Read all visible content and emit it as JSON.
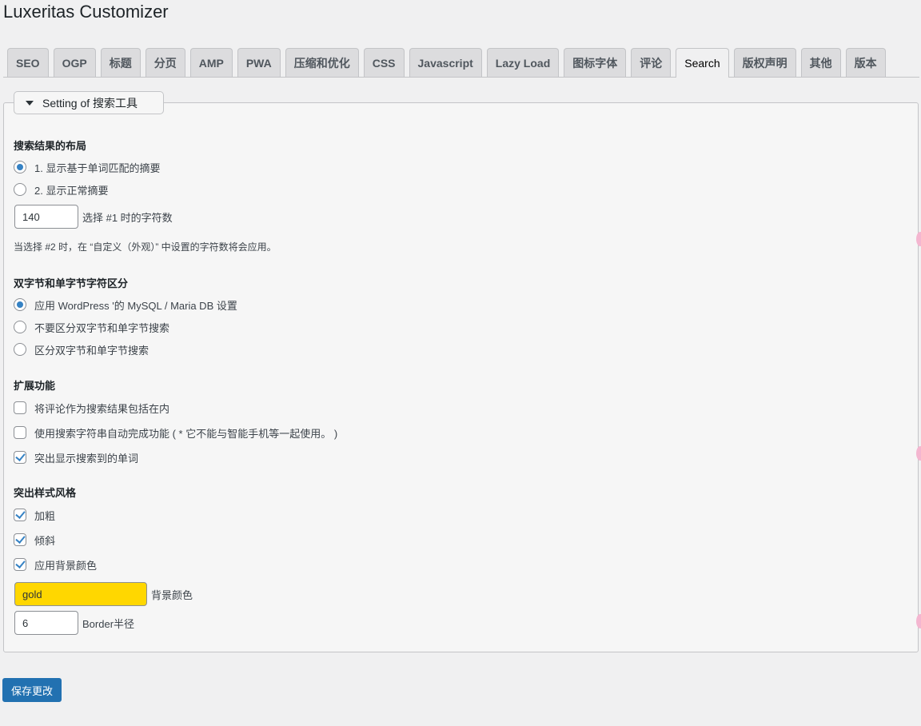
{
  "page": {
    "title": "Luxeritas Customizer"
  },
  "tabs": [
    {
      "label": "SEO",
      "active": false
    },
    {
      "label": "OGP",
      "active": false
    },
    {
      "label": "标题",
      "active": false
    },
    {
      "label": "分页",
      "active": false
    },
    {
      "label": "AMP",
      "active": false
    },
    {
      "label": "PWA",
      "active": false
    },
    {
      "label": "压缩和优化",
      "active": false
    },
    {
      "label": "CSS",
      "active": false
    },
    {
      "label": "Javascript",
      "active": false
    },
    {
      "label": "Lazy Load",
      "active": false
    },
    {
      "label": "图标字体",
      "active": false
    },
    {
      "label": "评论",
      "active": false
    },
    {
      "label": "Search",
      "active": true
    },
    {
      "label": "版权声明",
      "active": false
    },
    {
      "label": "其他",
      "active": false
    },
    {
      "label": "版本",
      "active": false
    }
  ],
  "panel": {
    "legend": "Setting of 搜索工具",
    "layout": {
      "title": "搜索结果的布局",
      "options": [
        {
          "label": "1. 显示基于单词匹配的摘要",
          "selected": true
        },
        {
          "label": "2. 显示正常摘要",
          "selected": false
        }
      ],
      "char_count": {
        "value": "140",
        "label": "选择 #1 时的字符数"
      },
      "note": "当选择 #2 时，在 “自定义（外观）” 中设置的字符数将会应用。"
    },
    "multibyte": {
      "title": "双字节和单字节字符区分",
      "options": [
        {
          "label": "应用 WordPress '的 MySQL / Maria DB 设置",
          "selected": true
        },
        {
          "label": "不要区分双字节和单字节搜索",
          "selected": false
        },
        {
          "label": "区分双字节和单字节搜索",
          "selected": false
        }
      ]
    },
    "extensions": {
      "title": "扩展功能",
      "options": [
        {
          "label": "将评论作为搜索结果包括在内",
          "checked": false
        },
        {
          "label": "使用搜索字符串自动完成功能 ( * 它不能与智能手机等一起使用。 )",
          "checked": false
        },
        {
          "label": "突出显示搜索到的单词",
          "checked": true
        }
      ]
    },
    "highlight": {
      "title": "突出样式风格",
      "options": [
        {
          "label": "加粗",
          "checked": true
        },
        {
          "label": "倾斜",
          "checked": true
        },
        {
          "label": "应用背景颜色",
          "checked": true
        }
      ],
      "bg_color": {
        "value": "gold",
        "label": "背景颜色",
        "swatch": "#ffd700"
      },
      "border_radius": {
        "value": "6",
        "label": "Border半径"
      }
    }
  },
  "save_button": "保存更改"
}
